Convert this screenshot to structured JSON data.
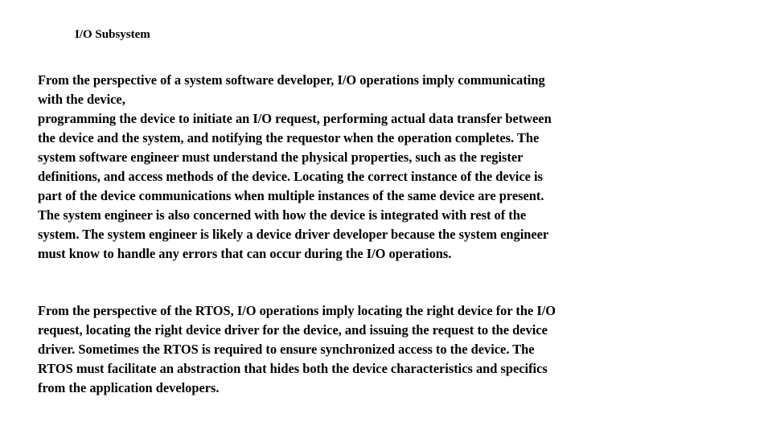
{
  "slide": {
    "title": "I/O Subsystem",
    "paragraphs": [
      {
        "lines": [
          "From the perspective of a system software developer, I/O operations imply communicating",
          "with the device,",
          "programming the device to initiate an I/O request, performing actual data transfer between",
          "the device and the system, and notifying the requestor when the operation completes. The",
          "system software engineer must understand the physical properties, such as the register",
          "definitions, and access methods of the device. Locating the correct instance of the device is",
          "part of the device communications when multiple instances of the same device are present.",
          "The system engineer is also concerned with how the device is integrated with rest of the",
          "system. The system engineer is likely a device driver developer because the system engineer",
          "must know to handle any errors that can occur during the I/O operations."
        ]
      },
      {
        "lines": [
          "From the perspective of the RTOS, I/O operations imply locating the right device for the I/O",
          "request, locating the right device driver for the device, and issuing the request to the device",
          "driver. Sometimes the RTOS is required to ensure synchronized access to the device. The",
          "RTOS must facilitate an abstraction that hides both the device characteristics and specifics",
          "from the application developers."
        ]
      }
    ]
  }
}
